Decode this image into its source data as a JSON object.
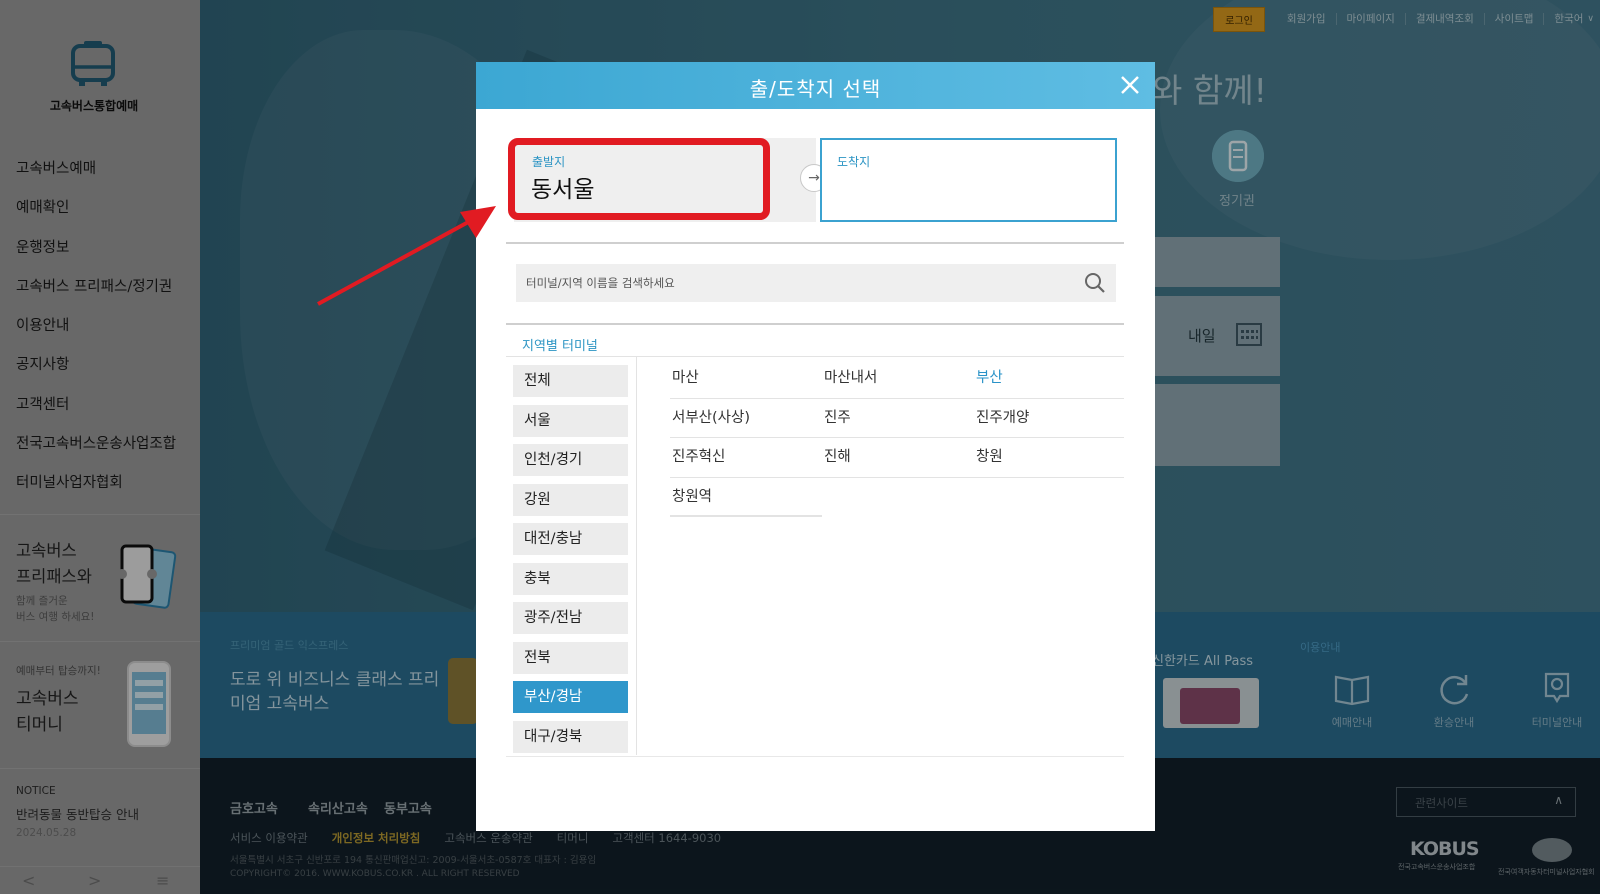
{
  "sidebar": {
    "logo_text": "고속버스통합예매",
    "menu": [
      "고속버스예매",
      "예매확인",
      "운행정보",
      "고속버스 프리패스/정기권",
      "이용안내",
      "공지사항",
      "고객센터",
      "전국고속버스운송사업조합",
      "터미널사업자협회"
    ],
    "promo1_title": "고속버스\n프리패스와",
    "promo1_sub": "함께 즐거운\n버스 여행 하세요!",
    "promo2_small": "예매부터 탑승까지!",
    "promo2_title": "고속버스\n티머니",
    "notice_label": "NOTICE",
    "notice_title": "반려동물 동반탑승 안내",
    "notice_date": "2024.05.28",
    "pager": [
      "<",
      ">",
      "≡"
    ]
  },
  "topnav": {
    "login": "로그인",
    "items": [
      "회원가입",
      "마이페이지",
      "결제내역조회",
      "사이트맵"
    ],
    "language": "한국어"
  },
  "hero": {
    "tagline": "와 함께!",
    "pass_label": "정기권",
    "date_label": "내일"
  },
  "banner": {
    "small": "프리미엄 골드 익스프레스",
    "title": "도로 위 비즈니스 클래스 프리미엄 고속버스",
    "allpass": "신한카드 All Pass",
    "usage_label": "이용안내",
    "usage_items": [
      "예매안내",
      "환승안내",
      "터미널안내"
    ]
  },
  "footer": {
    "logos": [
      "금호고속",
      "속리산고속",
      "동부고속"
    ],
    "links": [
      "서비스 이용약관",
      "개인정보 처리방침",
      "고속버스 운송약관",
      "티머니",
      "고객센터 1644-9030"
    ],
    "address": "서울특별시 서초구 신반포로 194 통신판매업신고: 2009-서울서초-0587호 대표자 : 김용임",
    "copyright": "COPYRIGHT© 2016. WWW.KOBUS.CO.KR . ALL RIGHT RESERVED",
    "related_sites": "관련사이트",
    "kobus": "KOBUS",
    "kobus_sub": "전국고속버스운송사업조합",
    "assoc_sub": "전국여객자동차터미널사업자협회"
  },
  "modal": {
    "title": "출/도착지 선택",
    "departure_label": "출발지",
    "departure_value": "동서울",
    "arrival_label": "도착지",
    "arrival_value": "",
    "search_placeholder": "터미널/지역 이름을 검색하세요",
    "region_title": "지역별 터미널",
    "regions": [
      "전체",
      "서울",
      "인천/경기",
      "강원",
      "대전/충남",
      "충북",
      "광주/전남",
      "전북",
      "부산/경남",
      "대구/경북"
    ],
    "active_region": "부산/경남",
    "terminals": [
      "마산",
      "마산내서",
      "부산",
      "서부산(사상)",
      "진주",
      "진주개양",
      "진주혁신",
      "진해",
      "창원",
      "창원역"
    ],
    "highlighted_terminal": "부산"
  },
  "colors": {
    "header_blue": "#3ca7d3",
    "active_region": "#2f97cb",
    "annotation_red": "#e11b22",
    "login_gold": "#d99a1f"
  }
}
